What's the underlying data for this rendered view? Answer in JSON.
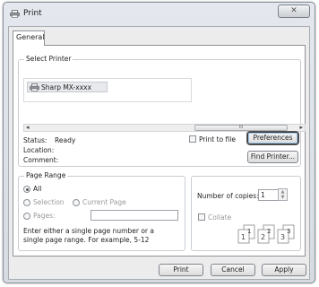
{
  "window": {
    "title": "Print",
    "close_glyph": "✕"
  },
  "tabs": [
    {
      "label": "General"
    }
  ],
  "select_printer": {
    "label": "Select Printer",
    "printers": [
      {
        "name": "Sharp MX-xxxx",
        "icon": "printer-icon"
      }
    ],
    "scroll_left": "◂",
    "scroll_right": "▸",
    "scroll_thumb": "III"
  },
  "status": {
    "status_label": "Status:",
    "status_value": "Ready",
    "location_label": "Location:",
    "location_value": "",
    "comment_label": "Comment:",
    "comment_value": "",
    "print_to_file_label": "Print to file",
    "preferences_label": "Preferences",
    "find_printer_label": "Find Printer..."
  },
  "page_range": {
    "label": "Page Range",
    "all_label": "All",
    "selection_label": "Selection",
    "current_page_label": "Current Page",
    "pages_label": "Pages:",
    "pages_value": "",
    "help_text_line1": "Enter either a single page number or a",
    "help_text_line2": "single page range. For example, 5-12"
  },
  "copies": {
    "number_label": "Number of copies:",
    "number_value": "1",
    "collate_label": "Collate",
    "collate_digits": [
      "1",
      "1",
      "2",
      "2",
      "3",
      "3"
    ]
  },
  "footer": {
    "print_label": "Print",
    "cancel_label": "Cancel",
    "apply_label": "Apply"
  }
}
